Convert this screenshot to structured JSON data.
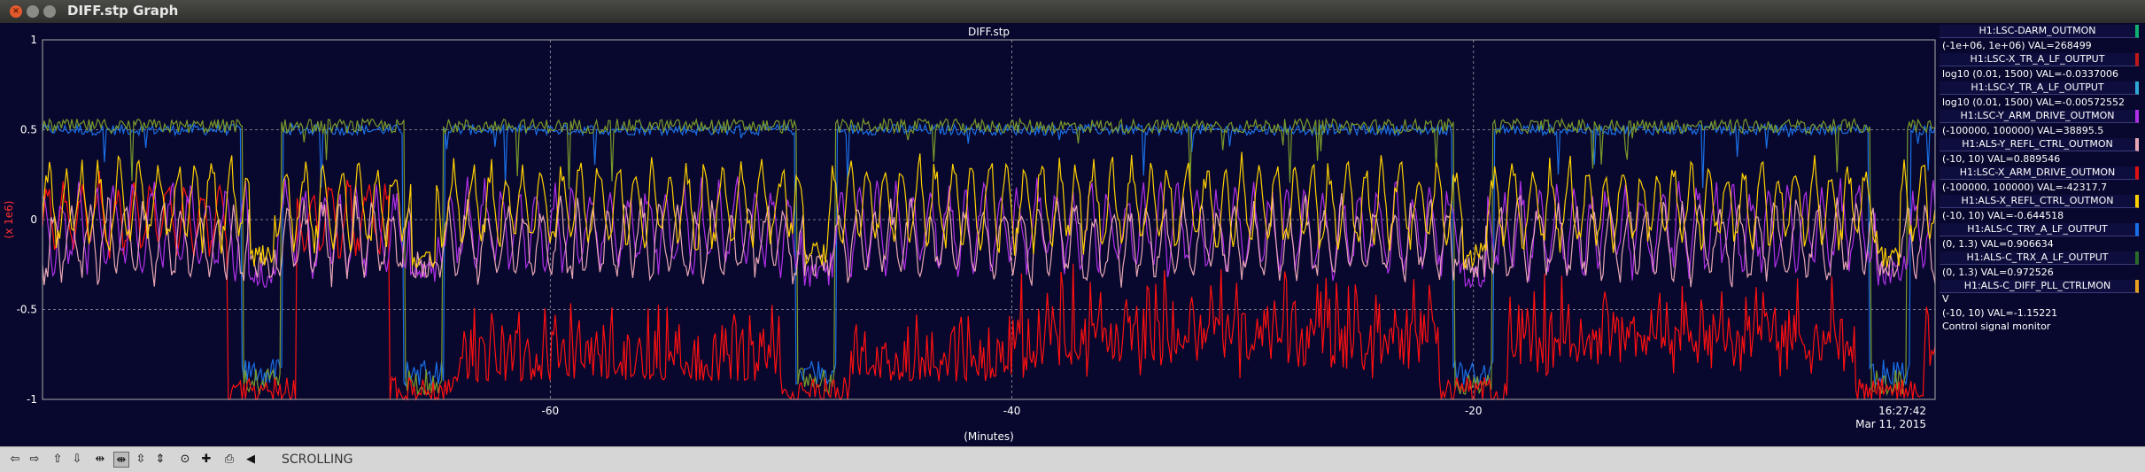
{
  "window": {
    "title": "DIFF.stp Graph",
    "close_glyph": "×"
  },
  "toolbar": {
    "buttons": [
      {
        "name": "scroll-left-icon",
        "glyph": "⇦"
      },
      {
        "name": "scroll-right-icon",
        "glyph": "⇨"
      },
      {
        "name": "scroll-up-icon",
        "glyph": "⇧"
      },
      {
        "name": "scroll-down-icon",
        "glyph": "⇩"
      },
      {
        "name": "zoom-x-icon",
        "glyph": "⇹"
      },
      {
        "name": "zoom-x-in-icon",
        "glyph": "⇼"
      },
      {
        "name": "zoom-y-out-icon",
        "glyph": "⇳"
      },
      {
        "name": "zoom-y-in-icon",
        "glyph": "⇕"
      },
      {
        "name": "center-icon",
        "glyph": "⊙"
      },
      {
        "name": "add-icon",
        "glyph": "✚"
      },
      {
        "name": "print-icon",
        "glyph": "⎙"
      },
      {
        "name": "speaker-icon",
        "glyph": "◀"
      }
    ],
    "mode_label": "SCROLLING"
  },
  "chart_data": {
    "type": "line",
    "title": "DIFF.stp",
    "xlabel": "(Minutes)",
    "ylabel": "(x 1e6)",
    "xlim": [
      -82,
      0
    ],
    "ylim": [
      -1,
      1
    ],
    "x_ticks": [
      -60,
      -40,
      -20
    ],
    "x_tick_labels": [
      "-60",
      "-40",
      "-20"
    ],
    "y_ticks": [
      1,
      0.5,
      0,
      -0.5,
      -1
    ],
    "y_tick_labels": [
      "1",
      "0.5",
      "0",
      "-0.5",
      "-1"
    ],
    "grid": true,
    "end_time": "16:27:42",
    "end_date": "Mar 11, 2015",
    "dropouts": [
      -72.5,
      -65.5,
      -48.5,
      -20.0,
      -2.0
    ],
    "series": [
      {
        "key": "darm",
        "color": "#1a6fe6",
        "base": 0.5,
        "amp": 0.03,
        "dip": -0.85,
        "dipw": 0.9
      },
      {
        "key": "trx",
        "color": "#7a9a2a",
        "base": 0.52,
        "amp": 0.04,
        "dip": -0.9,
        "dipw": 0.8
      },
      {
        "key": "xarm",
        "color": "#ff1010",
        "base": 0.0,
        "amp": 0.18,
        "dip": -0.95,
        "dipw": 1.5
      },
      {
        "key": "yarm",
        "color": "#b030e8",
        "base": -0.05,
        "amp": 0.2,
        "dip": -0.3,
        "dipw": 0.6
      },
      {
        "key": "yrefl",
        "color": "#e8a6b4",
        "base": -0.12,
        "amp": 0.18,
        "dip": -0.25,
        "dipw": 0.5
      },
      {
        "key": "xrefl",
        "color": "#ffd000",
        "base": 0.08,
        "amp": 0.2,
        "dip": -0.2,
        "dipw": 0.5
      }
    ]
  },
  "legend": [
    {
      "name": "H1:LSC-DARM_OUTMON",
      "range": "(-1e+06, 1e+06) VAL=268499",
      "color": "#10b070"
    },
    {
      "name": "H1:LSC-X_TR_A_LF_OUTPUT",
      "range": "log10 (0.01, 1500) VAL=-0.0337006",
      "color": "#c01818"
    },
    {
      "name": "H1:LSC-Y_TR_A_LF_OUTPUT",
      "range": "log10 (0.01, 1500) VAL=-0.00572552",
      "color": "#30a8d8"
    },
    {
      "name": "H1:LSC-Y_ARM_DRIVE_OUTMON",
      "range": "(-100000, 100000) VAL=38895.5",
      "color": "#b030e8"
    },
    {
      "name": "H1:ALS-Y_REFL_CTRL_OUTMON",
      "range": "(-10, 10) VAL=0.889546",
      "color": "#e8a6b4"
    },
    {
      "name": "H1:LSC-X_ARM_DRIVE_OUTMON",
      "range": "(-100000, 100000) VAL=-42317.7",
      "color": "#e01010"
    },
    {
      "name": "H1:ALS-X_REFL_CTRL_OUTMON",
      "range": "(-10, 10) VAL=-0.644518",
      "color": "#ffd000"
    },
    {
      "name": "H1:ALS-C_TRY_A_LF_OUTPUT",
      "range": "(0, 1.3) VAL=0.906634",
      "color": "#1a6fe6"
    },
    {
      "name": "H1:ALS-C_TRX_A_LF_OUTPUT",
      "range": "(0, 1.3) VAL=0.972526",
      "color": "#2a6a2a"
    },
    {
      "name": "H1:ALS-C_DIFF_PLL_CTRLMON",
      "range": "(-10, 10) VAL=-1.15221",
      "color": "#e8a020",
      "extra": "V",
      "desc": "Control signal monitor"
    }
  ]
}
